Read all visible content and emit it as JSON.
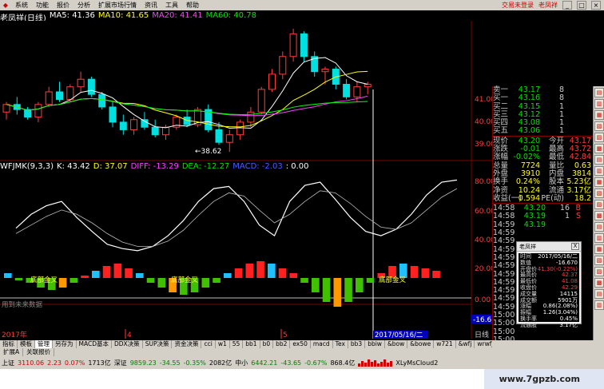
{
  "menu": {
    "items": [
      "系统",
      "功能",
      "报价",
      "分析",
      "扩展市场行情",
      "资讯",
      "工具",
      "帮助"
    ],
    "right_items": [
      "交易未登录",
      "老凤祥"
    ]
  },
  "ma_title": {
    "name": "老凤祥(日线)",
    "ma5": "MA5: 41.36",
    "ma10": "MA10: 41.65",
    "ma20": "MA20: 41.41",
    "ma60": "MA60: 40.78"
  },
  "price_axis": [
    "41.00",
    "40.00",
    "39.00"
  ],
  "low_label": "←38.62",
  "indicator_title": {
    "name": "WFJMK(9,3,3)",
    "k": "K: 43.42",
    "d": "D: 37.07",
    "diff": "DIFF: -13.29",
    "dea": "DEA: -12.27",
    "macd": "MACD: -2.03",
    "extra": ": 0.00"
  },
  "indicator_axis": [
    "80.00",
    "60.00",
    "40.00",
    "20.00",
    "0.00",
    "-16.67"
  ],
  "macd_labels": [
    "底部金叉",
    "底部金叉",
    "底部金叉"
  ],
  "date_axis": {
    "left_note": "用到未来数据",
    "ticks": [
      "2017年",
      "4",
      "5"
    ],
    "current": "2017/05/16/二",
    "period": "日线"
  },
  "colors": {
    "up": "#ff3c3c",
    "down": "#00e0e0",
    "ma5": "#ffffff",
    "ma10": "#ffff00",
    "ma20": "#ff40ff",
    "ma60": "#00ff00",
    "panel_border": "#800000"
  },
  "chart_data": {
    "type": "candlestick",
    "ylim": [
      38.5,
      43.5
    ],
    "candles": [
      [
        40.2,
        40.6,
        39.9,
        40.5
      ],
      [
        40.5,
        40.8,
        40.1,
        40.3
      ],
      [
        40.3,
        40.4,
        39.9,
        40.0
      ],
      [
        40.0,
        40.6,
        39.8,
        40.5
      ],
      [
        40.5,
        41.2,
        40.4,
        41.0
      ],
      [
        41.0,
        41.4,
        40.6,
        40.7
      ],
      [
        40.7,
        41.3,
        40.6,
        41.2
      ],
      [
        41.2,
        41.8,
        41.0,
        41.5
      ],
      [
        41.5,
        41.6,
        40.8,
        40.9
      ],
      [
        40.9,
        41.0,
        40.3,
        40.4
      ],
      [
        40.4,
        40.6,
        39.6,
        39.8
      ],
      [
        39.8,
        40.1,
        39.3,
        39.5
      ],
      [
        39.5,
        40.0,
        39.3,
        39.9
      ],
      [
        39.9,
        40.2,
        39.5,
        39.6
      ],
      [
        39.6,
        39.9,
        39.2,
        39.3
      ],
      [
        39.3,
        39.7,
        39.1,
        39.6
      ],
      [
        39.6,
        40.1,
        39.5,
        40.0
      ],
      [
        40.0,
        40.3,
        39.6,
        39.7
      ],
      [
        39.7,
        40.4,
        39.6,
        40.3
      ],
      [
        40.3,
        40.5,
        39.4,
        39.5
      ],
      [
        39.5,
        39.8,
        38.9,
        39.0
      ],
      [
        39.0,
        39.5,
        38.62,
        39.3
      ],
      [
        39.3,
        39.9,
        39.1,
        39.8
      ],
      [
        39.8,
        40.4,
        39.6,
        40.2
      ],
      [
        40.2,
        41.2,
        40.1,
        41.1
      ],
      [
        41.1,
        41.9,
        41.0,
        41.7
      ],
      [
        41.7,
        42.6,
        41.5,
        42.4
      ],
      [
        42.4,
        43.5,
        42.2,
        43.3
      ],
      [
        43.3,
        43.4,
        42.2,
        42.4
      ],
      [
        42.4,
        42.6,
        41.6,
        41.8
      ],
      [
        41.8,
        42.0,
        41.3,
        41.9
      ],
      [
        41.9,
        42.0,
        41.1,
        41.3
      ],
      [
        41.3,
        41.5,
        40.7,
        40.8
      ],
      [
        40.8,
        41.4,
        40.6,
        41.2
      ],
      [
        41.2,
        41.4,
        40.9,
        41.3
      ]
    ],
    "k_line": [
      45,
      58,
      66,
      70,
      55,
      42,
      30,
      26,
      24,
      28,
      38,
      52,
      70,
      82,
      84,
      70,
      48,
      38,
      70,
      85,
      88,
      72,
      55,
      42,
      38,
      44,
      58,
      76,
      88,
      90
    ],
    "d_line": [
      40,
      48,
      56,
      62,
      58,
      50,
      40,
      32,
      28,
      28,
      33,
      43,
      57,
      70,
      78,
      75,
      62,
      50,
      58,
      70,
      80,
      78,
      68,
      56,
      46,
      44,
      50,
      62,
      74,
      82
    ],
    "macd_bars": [
      1,
      -0.5,
      -1,
      -2,
      -2.5,
      -2,
      -1,
      0.5,
      1.5,
      2.5,
      3,
      2,
      1,
      -1,
      -2,
      -3,
      -3.5,
      -3,
      -2,
      -1,
      1,
      2,
      3,
      3.5,
      3,
      2,
      1,
      -1,
      -3,
      -5,
      -6,
      -5,
      -3,
      -1,
      1,
      2.5,
      3,
      2.5,
      2,
      1.5
    ],
    "xlabel": "",
    "ylabel": ""
  },
  "quote_panel": {
    "asks": [
      {
        "label": "卖一",
        "price": "43.17",
        "vol": "8"
      },
      {
        "label": "买一",
        "price": "43.16",
        "vol": "8"
      },
      {
        "label": "买二",
        "price": "43.15",
        "vol": "1"
      },
      {
        "label": "买三",
        "price": "43.12",
        "vol": "1"
      },
      {
        "label": "买四",
        "price": "43.08",
        "vol": "1"
      },
      {
        "label": "买五",
        "price": "43.06",
        "vol": "1"
      }
    ],
    "stats": [
      {
        "l1": "现价",
        "v1": "43.20",
        "l2": "今开",
        "v2": "43.17"
      },
      {
        "l1": "涨跌",
        "v1": "-0.01",
        "l2": "最高",
        "v2": "43.72"
      },
      {
        "l1": "涨幅",
        "v1": "-0.02%",
        "l2": "最低",
        "v2": "42.84"
      },
      {
        "l1": "总量",
        "v1": "7724",
        "l2": "量比",
        "v2": "0.63"
      },
      {
        "l1": "外盘",
        "v1": "3910",
        "l2": "内盘",
        "v2": "3814"
      },
      {
        "l1": "换手",
        "v1": "0.24%",
        "l2": "股本",
        "v2": "5.23亿"
      },
      {
        "l1": "净资",
        "v1": "10.24",
        "l2": "流通",
        "v2": "3.17亿"
      },
      {
        "l1": "收益(一)",
        "v1": "0.594",
        "l2": "PE(动)",
        "v2": "18.2"
      }
    ],
    "ticks": [
      {
        "time": "14:58",
        "price": "43.20",
        "vol": "16",
        "flag": "B"
      },
      {
        "time": "14:58",
        "price": "43.19",
        "vol": "1",
        "flag": "S"
      },
      {
        "time": "14:59",
        "price": "43.19",
        "vol": "",
        "flag": ""
      },
      {
        "time": "14:59",
        "price": "",
        "vol": "",
        "flag": ""
      },
      {
        "time": "14:59",
        "price": "",
        "vol": "",
        "flag": ""
      },
      {
        "time": "14:59",
        "price": "",
        "vol": "",
        "flag": ""
      },
      {
        "time": "14:59",
        "price": "",
        "vol": "",
        "flag": ""
      },
      {
        "time": "14:59",
        "price": "",
        "vol": "",
        "flag": ""
      },
      {
        "time": "14:59",
        "price": "",
        "vol": "",
        "flag": ""
      },
      {
        "time": "14:59",
        "price": "",
        "vol": "",
        "flag": ""
      },
      {
        "time": "14:59",
        "price": "",
        "vol": "",
        "flag": ""
      },
      {
        "time": "14:59",
        "price": "",
        "vol": "",
        "flag": ""
      },
      {
        "time": "14:59",
        "price": "",
        "vol": "",
        "flag": ""
      },
      {
        "time": "15:00",
        "price": "",
        "vol": "",
        "flag": ""
      },
      {
        "time": "15:00",
        "price": "",
        "vol": "",
        "flag": ""
      },
      {
        "time": "15:00",
        "price": "",
        "vol": "",
        "flag": ""
      },
      {
        "time": "15:00",
        "price": "",
        "vol": "",
        "flag": ""
      }
    ]
  },
  "tooltip": {
    "title": "老凤祥",
    "close": "X",
    "rows": [
      {
        "l": "时间",
        "v": "2017/05/16/二"
      },
      {
        "l": "数值",
        "v": "-16.670"
      },
      {
        "l": "开盘价",
        "v": "41.30(-0.22%)"
      },
      {
        "l": "最高价",
        "v": "42.37"
      },
      {
        "l": "最低价",
        "v": "41.08"
      },
      {
        "l": "收盘价",
        "v": "42.29"
      },
      {
        "l": "成交量",
        "v": "14115"
      },
      {
        "l": "成交额",
        "v": "5901万"
      },
      {
        "l": "涨幅",
        "v": "0.86(2.08%)"
      },
      {
        "l": "振幅",
        "v": "1.26(3.04%)"
      },
      {
        "l": "换手率",
        "v": "0.45%"
      },
      {
        "l": "流通股",
        "v": "3.17亿"
      }
    ]
  },
  "tabs1": [
    "指标",
    "模板",
    "管理",
    "另存为",
    "MACD基本",
    "DDX决策",
    "SUP决策",
    "资金决策",
    "cci",
    "w1",
    "55",
    "bb1",
    "b0",
    "bb2",
    "ex50",
    "macd",
    "Tex",
    "bb3",
    "bbiw",
    "&bow",
    "&bowe",
    "w721",
    "&wfj",
    "wrwfj",
    "mkwfj",
    "筹码",
    "rsi",
    "8v",
    "wfj",
    "wfj2",
    "v2"
  ],
  "tabs1_active": "管理",
  "tabs2": [
    "扩展A",
    "关联报价"
  ],
  "statusbar": {
    "sh_label": "上证",
    "sh_value": "3110.06",
    "sh_change": "2.23",
    "sh_pct": "0.07%",
    "sh_amount": "1713亿",
    "sz_label": "深证",
    "sz_value": "9859.23",
    "sz_change": "-34.55",
    "sz_pct": "-0.35%",
    "sz_amount": "2082亿",
    "zx_label": "中小",
    "zx_value": "6442.21",
    "zx_change": "-43.65",
    "zx_pct": "-0.67%",
    "zx_amount": "868.4亿",
    "cloud": "XLyMsCloud2"
  },
  "watermark": "www.7gpzb.com"
}
